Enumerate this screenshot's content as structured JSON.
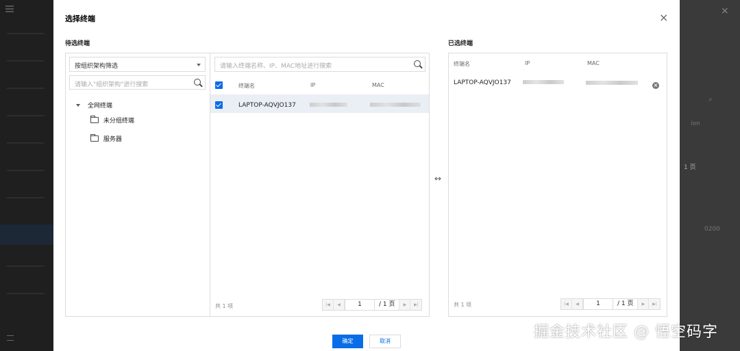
{
  "background": {
    "right_texts": [
      "ion",
      "1 页",
      "0200"
    ]
  },
  "dialog": {
    "title": "选择终端",
    "close_glyph": "×"
  },
  "candidates": {
    "label": "待选终端",
    "filter_select": "按组织架构筛选",
    "org_search_placeholder": "请输入\"组织架构\"进行搜索",
    "tree": {
      "root": "全网终端",
      "children": [
        "未分组终端",
        "服务器"
      ]
    },
    "terminal_search_placeholder": "请输入终端名称、IP、MAC地址进行搜索",
    "columns": [
      "终端名",
      "IP",
      "MAC"
    ],
    "rows": [
      {
        "name": "LAPTOP-AQVJO137",
        "ip": "",
        "mac": "",
        "checked": true
      }
    ],
    "count": "共 1 项",
    "pager": {
      "page": "1",
      "total": "/ 1 页"
    }
  },
  "swap_glyph": "↔",
  "selected": {
    "label": "已选终端",
    "columns": [
      "终端名",
      "IP",
      "MAC"
    ],
    "rows": [
      {
        "name": "LAPTOP-AQVJO137",
        "ip": "",
        "mac": ""
      }
    ],
    "count": "共 1 项",
    "pager": {
      "page": "1",
      "total": "/ 1 页"
    }
  },
  "buttons": {
    "confirm": "确定",
    "cancel": "取消"
  },
  "watermark": "掘金技术社区 @ 悟空码字",
  "colors": {
    "primary": "#0a6de8",
    "selected_row": "#eaeef5",
    "border": "#dcdcdc"
  }
}
